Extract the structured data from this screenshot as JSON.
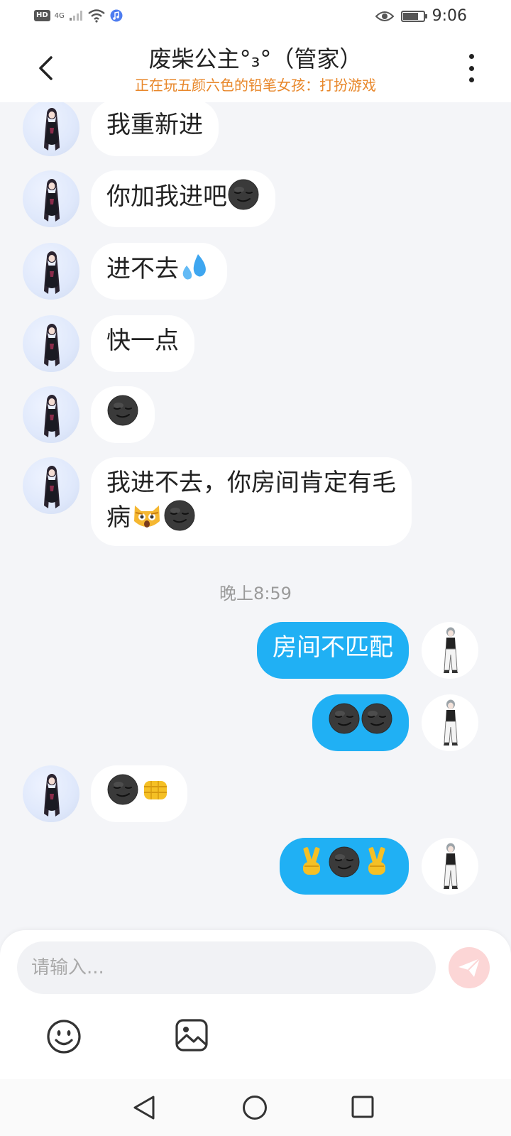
{
  "status_bar": {
    "hd": "HD",
    "network": "4G",
    "time": "9:06",
    "battery_level": 0.7
  },
  "header": {
    "title": "废柴公主°₃°（管家）",
    "subtitle": "正在玩五颜六色的铅笔女孩：打扮游戏",
    "icons": {
      "back": "chevron-left-icon",
      "more": "more-vertical-icon"
    }
  },
  "messages": [
    {
      "side": "in",
      "text": "我重新进",
      "emojis": []
    },
    {
      "side": "in",
      "text": "你加我进吧",
      "emojis": [
        "smirk-dark-emoji"
      ]
    },
    {
      "side": "in",
      "text": "进不去",
      "emojis": [
        "sweat-drops-emoji"
      ]
    },
    {
      "side": "in",
      "text": "快一点",
      "emojis": []
    },
    {
      "side": "in",
      "text": "",
      "emojis": [
        "smirk-dark-emoji"
      ]
    },
    {
      "side": "in",
      "text": "我进不去，你房间肯定有毛",
      "text2": "病",
      "emojis": [
        "scared-cat-emoji",
        "smirk-dark-emoji"
      ]
    },
    {
      "side": "divider",
      "text": "晚上8:59"
    },
    {
      "side": "out",
      "text": "房间不匹配",
      "emojis": []
    },
    {
      "side": "out",
      "text": "",
      "emojis": [
        "smirk-dark-emoji",
        "smirk-dark-emoji"
      ]
    },
    {
      "side": "in",
      "text": "",
      "emojis": [
        "smirk-dark-emoji",
        "fist-bump-emoji"
      ]
    },
    {
      "side": "out",
      "text": "",
      "emojis": [
        "victory-hand-emoji",
        "smirk-dark-emoji",
        "victory-hand-emoji"
      ]
    }
  ],
  "input": {
    "placeholder": "请输入...",
    "value": ""
  },
  "toolbar": {
    "emoji_icon": "smiley-icon",
    "image_icon": "image-icon",
    "send_icon": "send-icon"
  },
  "nav": {
    "back_icon": "triangle-back-icon",
    "home_icon": "circle-home-icon",
    "recent_icon": "square-recent-icon"
  },
  "colors": {
    "accent": "#20b0f4",
    "subtitle": "#e8872a",
    "background": "#f4f5f8",
    "bubble_in": "#ffffff"
  }
}
